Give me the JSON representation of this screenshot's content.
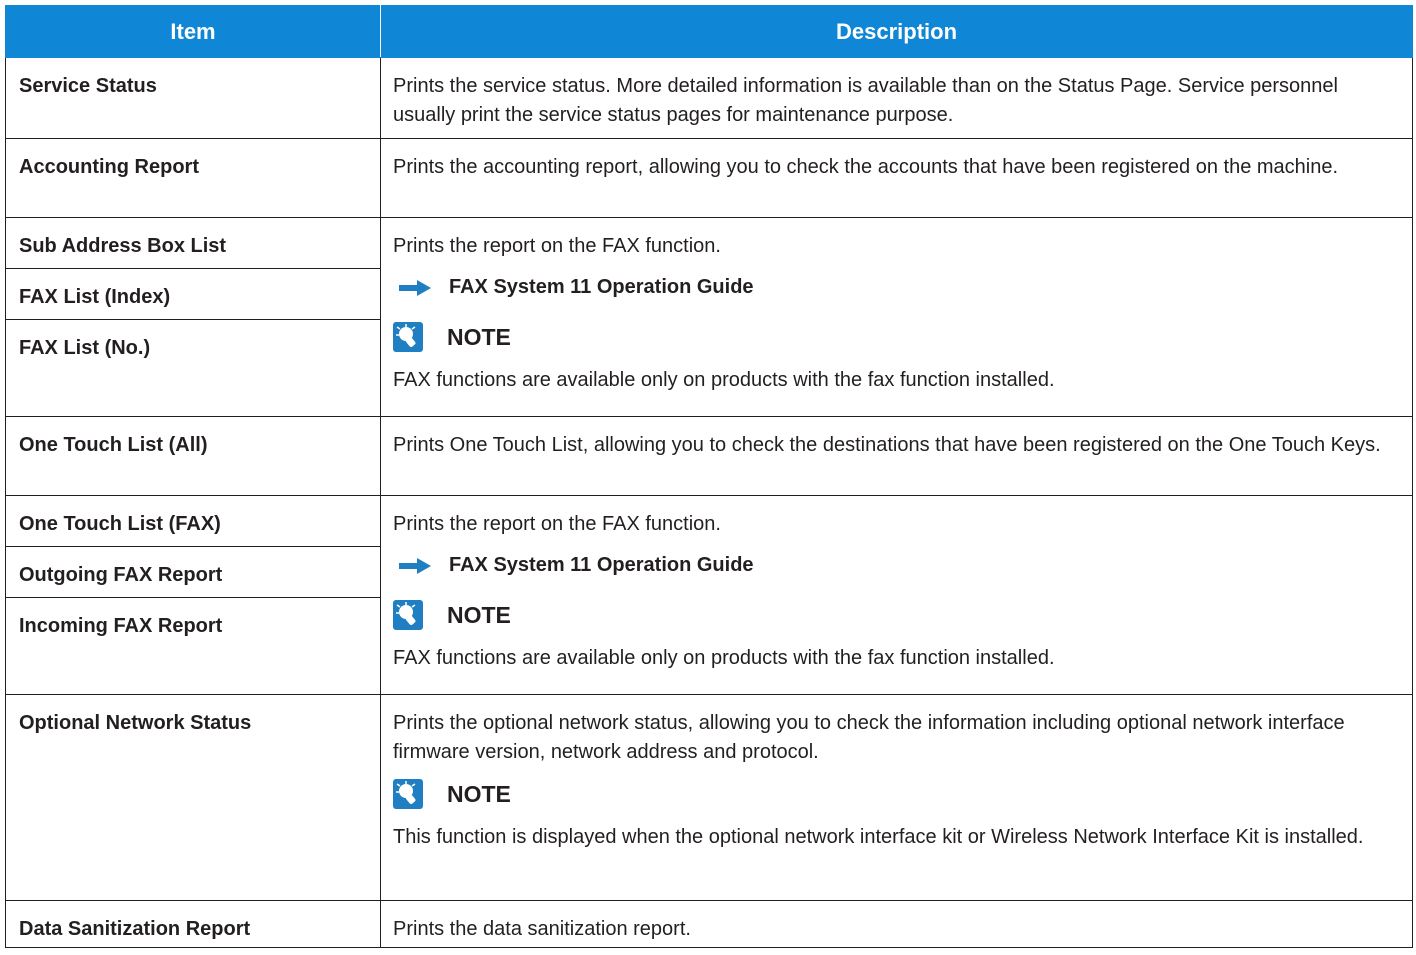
{
  "header": {
    "item": "Item",
    "description": "Description"
  },
  "rows": {
    "service_status": {
      "item": "Service Status",
      "desc": "Prints the service status. More detailed information is available than on the Status Page. Service personnel usually print the service status pages for maintenance purpose."
    },
    "accounting": {
      "item": "Accounting Report",
      "desc": "Prints the accounting report, allowing you to check the accounts that have been registered on the machine."
    },
    "fax_group1": {
      "items": [
        "Sub Address Box List",
        "FAX List (Index)",
        "FAX List (No.)"
      ],
      "desc": "Prints the report on the FAX function.",
      "ref": "FAX System 11 Operation Guide",
      "note_title": "NOTE",
      "note_text": "FAX functions are available only on products with the fax function installed."
    },
    "one_touch_all": {
      "item": "One Touch List (All)",
      "desc": "Prints One Touch List, allowing you to check the destinations that have been registered on the One Touch Keys."
    },
    "fax_group2": {
      "items": [
        "One Touch List (FAX)",
        "Outgoing FAX Report",
        "Incoming FAX Report"
      ],
      "desc": "Prints the report on the FAX function.",
      "ref": "FAX System 11 Operation Guide",
      "note_title": "NOTE",
      "note_text": "FAX functions are available only on products with the fax function installed."
    },
    "optional_network": {
      "item": "Optional Network Status",
      "desc": "Prints the optional network status, allowing you to check the information including optional network interface firmware version, network address and protocol.",
      "note_title": "NOTE",
      "note_text": "This function is displayed when the optional network interface kit or Wireless Network Interface Kit is installed."
    },
    "data_sanitization": {
      "item": "Data Sanitization Report",
      "desc": "Prints the data sanitization report."
    }
  },
  "colors": {
    "header_bg": "#0f86d6",
    "header_text": "#ffffff",
    "border": "#231f20",
    "icon": "#1f7fc2"
  },
  "icons": {
    "reference": "arrow-right-icon",
    "note": "lightbulb-icon"
  }
}
